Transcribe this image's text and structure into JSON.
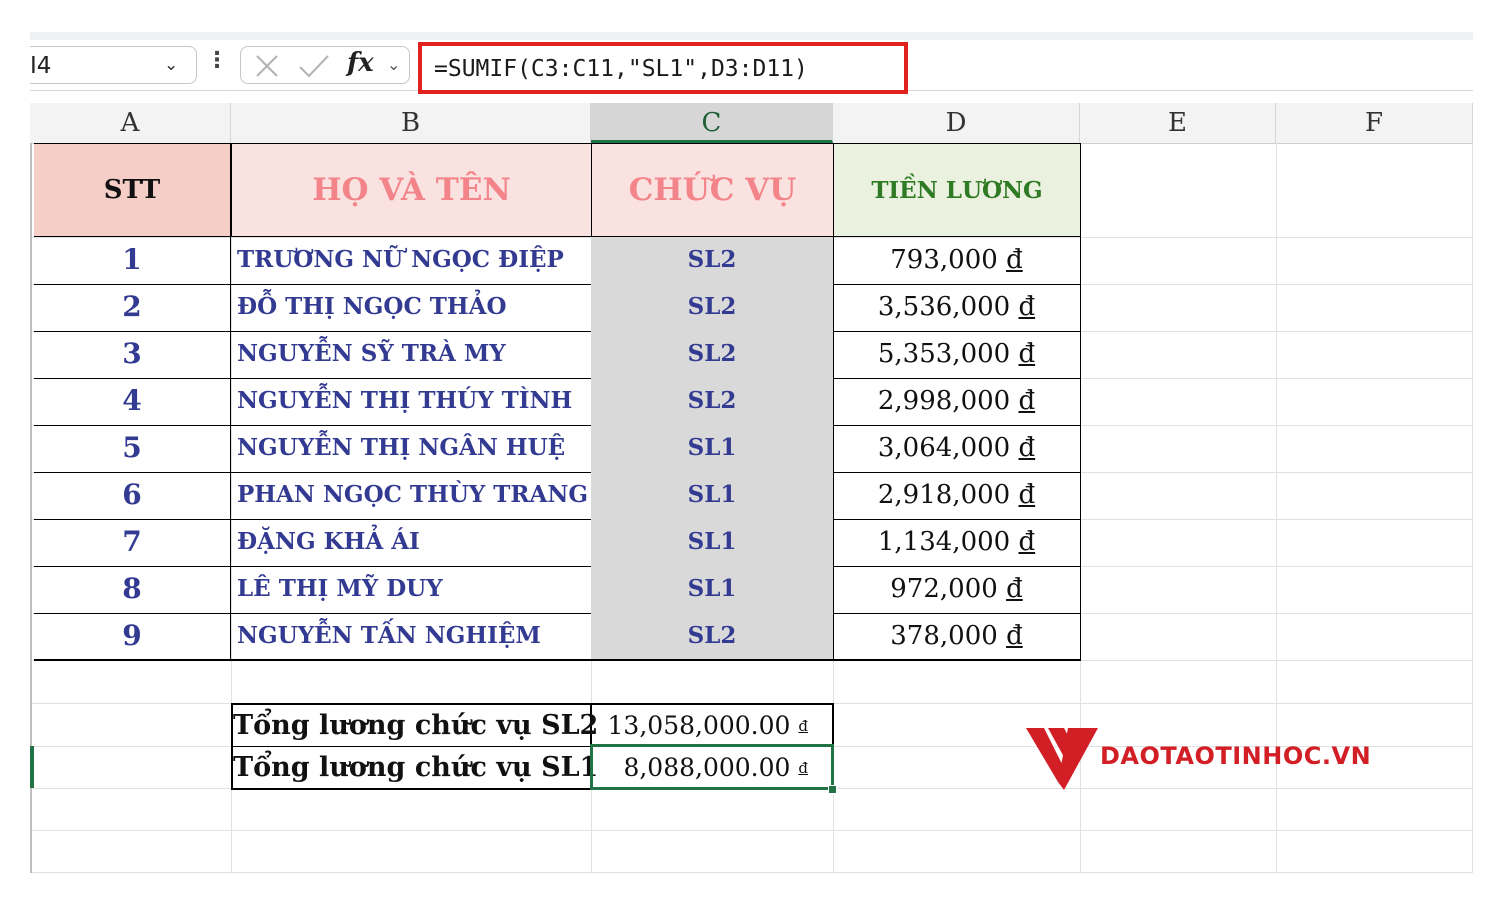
{
  "formula_bar": {
    "name_box": "I4",
    "fx_label": "fx",
    "formula": "=SUMIF(C3:C11,\"SL1\",D3:D11)"
  },
  "columns": [
    "A",
    "B",
    "C",
    "D",
    "E",
    "F"
  ],
  "table": {
    "headers": {
      "stt": "STT",
      "name": "HỌ VÀ TÊN",
      "position": "CHỨC VỤ",
      "salary": "TIỀN LƯƠNG"
    },
    "rows": [
      {
        "stt": "1",
        "name": "TRƯƠNG NỮ NGỌC ĐIỆP",
        "position": "SL2",
        "salary": "793,000"
      },
      {
        "stt": "2",
        "name": "ĐỖ THỊ NGỌC THẢO",
        "position": "SL2",
        "salary": "3,536,000"
      },
      {
        "stt": "3",
        "name": "NGUYỄN SỸ TRÀ MY",
        "position": "SL2",
        "salary": "5,353,000"
      },
      {
        "stt": "4",
        "name": "NGUYỄN THỊ THÚY TÌNH",
        "position": "SL2",
        "salary": "2,998,000"
      },
      {
        "stt": "5",
        "name": "NGUYỄN THỊ NGÂN HUỆ",
        "position": "SL1",
        "salary": "3,064,000"
      },
      {
        "stt": "6",
        "name": "PHAN NGỌC THÙY TRANG",
        "position": "SL1",
        "salary": "2,918,000"
      },
      {
        "stt": "7",
        "name": "ĐẶNG KHẢ ÁI",
        "position": "SL1",
        "salary": "1,134,000"
      },
      {
        "stt": "8",
        "name": "LÊ THỊ MỸ DUY",
        "position": "SL1",
        "salary": "972,000"
      },
      {
        "stt": "9",
        "name": "NGUYỄN TẤN NGHIỆM",
        "position": "SL2",
        "salary": "378,000"
      }
    ],
    "currency_symbol": "đ"
  },
  "summary": [
    {
      "label": "Tổng lương chức vụ SL2",
      "value": "13,058,000.00"
    },
    {
      "label": "Tổng lương chức vụ SL1",
      "value": "8,088,000.00"
    }
  ],
  "watermark": {
    "text": "DAOTAOTINHOC.VN"
  },
  "colors": {
    "accent_green": "#217346",
    "highlight_red": "#e0221e",
    "name_blue": "#323a92"
  }
}
